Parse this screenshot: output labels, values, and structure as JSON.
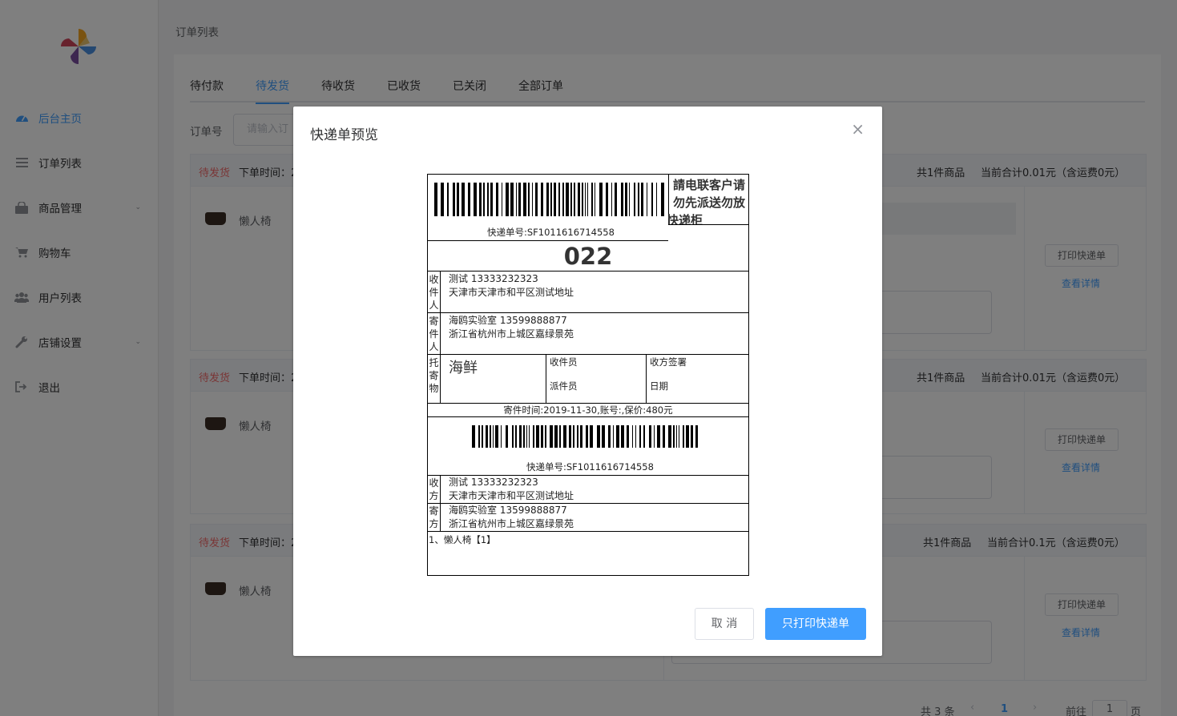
{
  "sidebar": {
    "items": [
      {
        "label": "后台主页",
        "icon": "dashboard-icon",
        "active": true
      },
      {
        "label": "订单列表",
        "icon": "list-icon"
      },
      {
        "label": "商品管理",
        "icon": "bag-icon",
        "expandable": true
      },
      {
        "label": "购物车",
        "icon": "cart-icon"
      },
      {
        "label": "用户列表",
        "icon": "users-icon"
      },
      {
        "label": "店铺设置",
        "icon": "wrench-icon",
        "expandable": true
      },
      {
        "label": "退出",
        "icon": "logout-icon"
      }
    ]
  },
  "breadcrumb": "订单列表",
  "tabs": [
    "待付款",
    "待发货",
    "待收货",
    "已收货",
    "已关闭",
    "全部订单"
  ],
  "active_tab": "待发货",
  "search": {
    "label": "订单号",
    "placeholder": "请输入订"
  },
  "orders": [
    {
      "status": "待发货",
      "time_label": "下单时间：2",
      "count": "共1件商品",
      "total": "当前合计0.01元（含运费0元）",
      "product": "懒人椅",
      "print_btn": "打印快递单",
      "detail_link": "查看详情"
    },
    {
      "status": "待发货",
      "time_label": "下单时间：2",
      "count": "共1件商品",
      "total": "当前合计0.01元（含运费0元）",
      "product": "懒人椅",
      "print_btn": "打印快递单",
      "detail_link": "查看详情"
    },
    {
      "status": "待发货",
      "time_label": "下单时间：2",
      "count": "共1件商品",
      "total": "当前合计0.1元（含运费0元）",
      "product": "懒人椅",
      "print_btn": "打印快递单",
      "detail_link": "查看详情"
    }
  ],
  "pagination": {
    "total": "共 3 条",
    "prev": "‹",
    "current": "1",
    "next": "›",
    "goto": "前往",
    "page_input": "1",
    "page_suffix": "页"
  },
  "dialog": {
    "title": "快递单预览",
    "close": "×",
    "cancel": "取 消",
    "print": "只打印快递单",
    "waybill": {
      "notice_lines": [
        "請电联客户请",
        "勿先派送勿放",
        "快递柜"
      ],
      "tracking_top": "快递单号:SF1011616714558",
      "code": "022",
      "recipient_label": [
        "收",
        "件",
        "人"
      ],
      "recipient_name": "测试 13333232323",
      "recipient_addr": "天津市天津市和平区测试地址",
      "sender_label": [
        "寄",
        "件",
        "人"
      ],
      "sender_name": "海鸥实验室 13599888877",
      "sender_addr": "浙江省杭州市上城区嘉绿景苑",
      "goods_label": [
        "托",
        "寄",
        "物"
      ],
      "goods": "海鲜",
      "collector": "收件员",
      "deliverer": "派件员",
      "sign": "收方签署",
      "date": "日期",
      "meta": "寄件时间:2019-11-30,账号:,保价:480元",
      "tracking_bottom": "快递单号:SF1011616714558",
      "r_label": [
        "收",
        "方"
      ],
      "s_label": [
        "寄",
        "方"
      ],
      "item_line": "1、懒人椅【1】"
    }
  }
}
